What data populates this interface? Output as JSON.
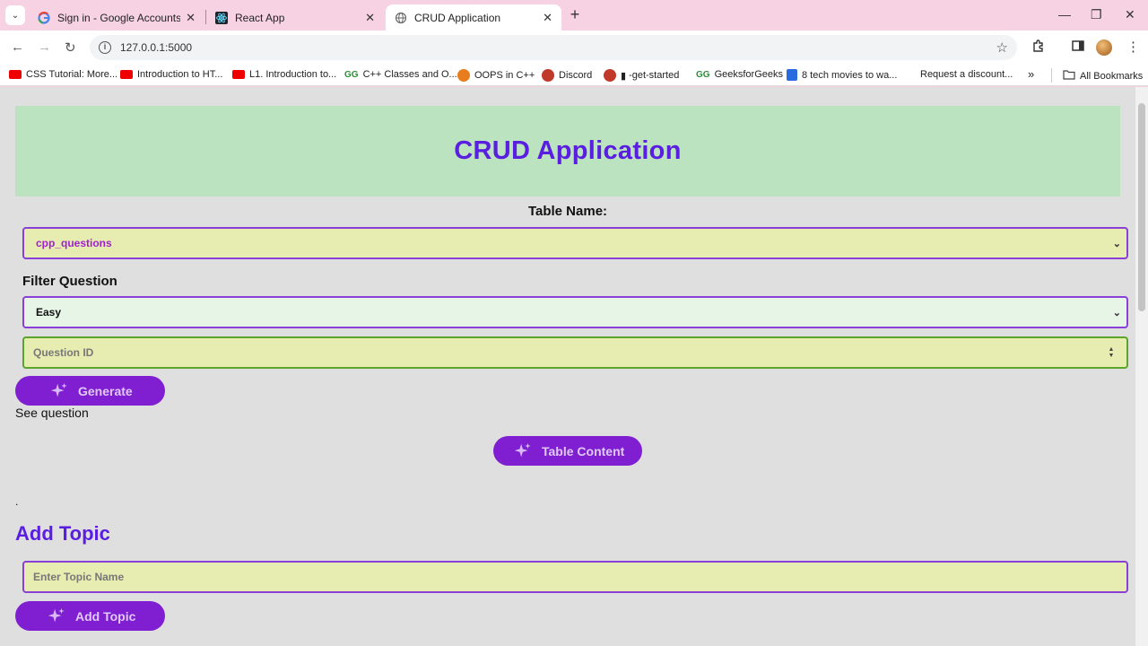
{
  "browser": {
    "tabs": [
      {
        "title": "Sign in - Google Accounts",
        "icon": "google-icon"
      },
      {
        "title": "React App",
        "icon": "react-icon"
      },
      {
        "title": "CRUD Application",
        "icon": "globe-icon",
        "active": true
      }
    ],
    "url": "127.0.0.1:5000",
    "bookmarks": [
      {
        "label": "CSS Tutorial: More...",
        "icon": "youtube-icon"
      },
      {
        "label": "Introduction to HT...",
        "icon": "youtube-icon"
      },
      {
        "label": "L1. Introduction to...",
        "icon": "youtube-icon"
      },
      {
        "label": "C++ Classes and O...",
        "icon": "gfg-icon"
      },
      {
        "label": "OOPS in C++",
        "icon": "codechef-icon"
      },
      {
        "label": "Discord",
        "icon": "discord-icon"
      },
      {
        "label": "-get-started",
        "icon": "site-icon"
      },
      {
        "label": "GeeksforGeeks",
        "icon": "gfg-icon"
      },
      {
        "label": "8 tech movies to wa...",
        "icon": "doc-icon"
      },
      {
        "label": "Request a discount...",
        "icon": "none"
      }
    ],
    "all_bookmarks": "All Bookmarks"
  },
  "app": {
    "title": "CRUD Application",
    "table_name_label": "Table Name:",
    "table_select_value": "cpp_questions",
    "filter_label": "Filter Question",
    "filter_select_value": "Easy",
    "question_id_placeholder": "Question ID",
    "generate_button": "Generate",
    "see_question": "See question",
    "table_content_button": "Table Content",
    "dot_text": ".",
    "add_topic_title": "Add Topic",
    "topic_placeholder": "Enter Topic Name",
    "add_topic_button": "Add Topic"
  },
  "colors": {
    "accent_purple": "#7f1fd1",
    "title_purple": "#5a1ee0",
    "header_green": "#bce3c0",
    "field_yellow": "#e7edb0"
  }
}
